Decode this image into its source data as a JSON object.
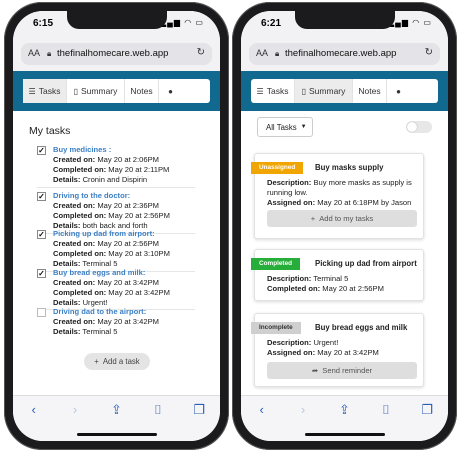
{
  "left": {
    "status_time": "6:15",
    "url": "thefinalhomecare.web.app",
    "url_aa": "AA",
    "tabs": [
      "Tasks",
      "Summary",
      "Notes"
    ],
    "section_title": "My tasks",
    "tasks": [
      {
        "title": "Buy medicines :",
        "checked": true,
        "lines": [
          [
            "Created on:",
            "May 20 at 2:06PM"
          ],
          [
            "Completed on:",
            "May 20 at 2:11PM"
          ],
          [
            "Details:",
            "Cronin and Dispirin"
          ]
        ]
      },
      {
        "title": "Driving to the doctor:",
        "checked": true,
        "lines": [
          [
            "Created on:",
            "May 20 at 2:36PM"
          ],
          [
            "Completed on:",
            "May 20 at 2:56PM"
          ],
          [
            "Details:",
            "both back and forth"
          ]
        ]
      },
      {
        "title": "Picking up dad from airport:",
        "checked": true,
        "lines": [
          [
            "Created on:",
            "May 20 at 2:56PM"
          ],
          [
            "Completed on:",
            "May 20 at 3:10PM"
          ],
          [
            "Details:",
            "Terminal 5"
          ]
        ]
      },
      {
        "title": "Buy bread eggs and milk:",
        "checked": true,
        "lines": [
          [
            "Created on:",
            "May 20 at 3:42PM"
          ],
          [
            "Completed on:",
            "May 20 at 3:42PM"
          ],
          [
            "Details:",
            "Urgent!"
          ]
        ]
      },
      {
        "title": "Driving dad to the airport:",
        "checked": false,
        "lines": [
          [
            "Created on:",
            "May 20 at 3:42PM"
          ],
          [
            "Details:",
            "Terminal 5"
          ]
        ]
      }
    ],
    "add_button": "Add a task"
  },
  "right": {
    "status_time": "6:21",
    "url": "thefinalhomecare.web.app",
    "url_aa": "AA",
    "tabs": [
      "Tasks",
      "Summary",
      "Notes"
    ],
    "filter_label": "All Tasks",
    "cards": [
      {
        "badge": "Unassigned",
        "badge_color": "#f0a500",
        "title": "Buy masks supply",
        "lines": [
          [
            "Description:",
            "Buy more masks as supply is running low."
          ],
          [
            "Assigned on:",
            "May 20 at 6:18PM by Jason"
          ]
        ],
        "button": "Add to my tasks"
      },
      {
        "badge": "Completed",
        "badge_color": "#27ae3a",
        "title": "Picking up dad from airport",
        "lines": [
          [
            "Description:",
            "Terminal 5"
          ],
          [
            "Completed on:",
            "May 20 at 2:56PM"
          ]
        ],
        "button": ""
      },
      {
        "badge": "Incomplete",
        "badge_color": "#cfcfcf",
        "title": "Buy bread eggs and milk",
        "lines": [
          [
            "Description:",
            "Urgent!"
          ],
          [
            "Assigned on:",
            "May 20 at 3:42PM"
          ]
        ],
        "button": "Send reminder"
      }
    ]
  }
}
